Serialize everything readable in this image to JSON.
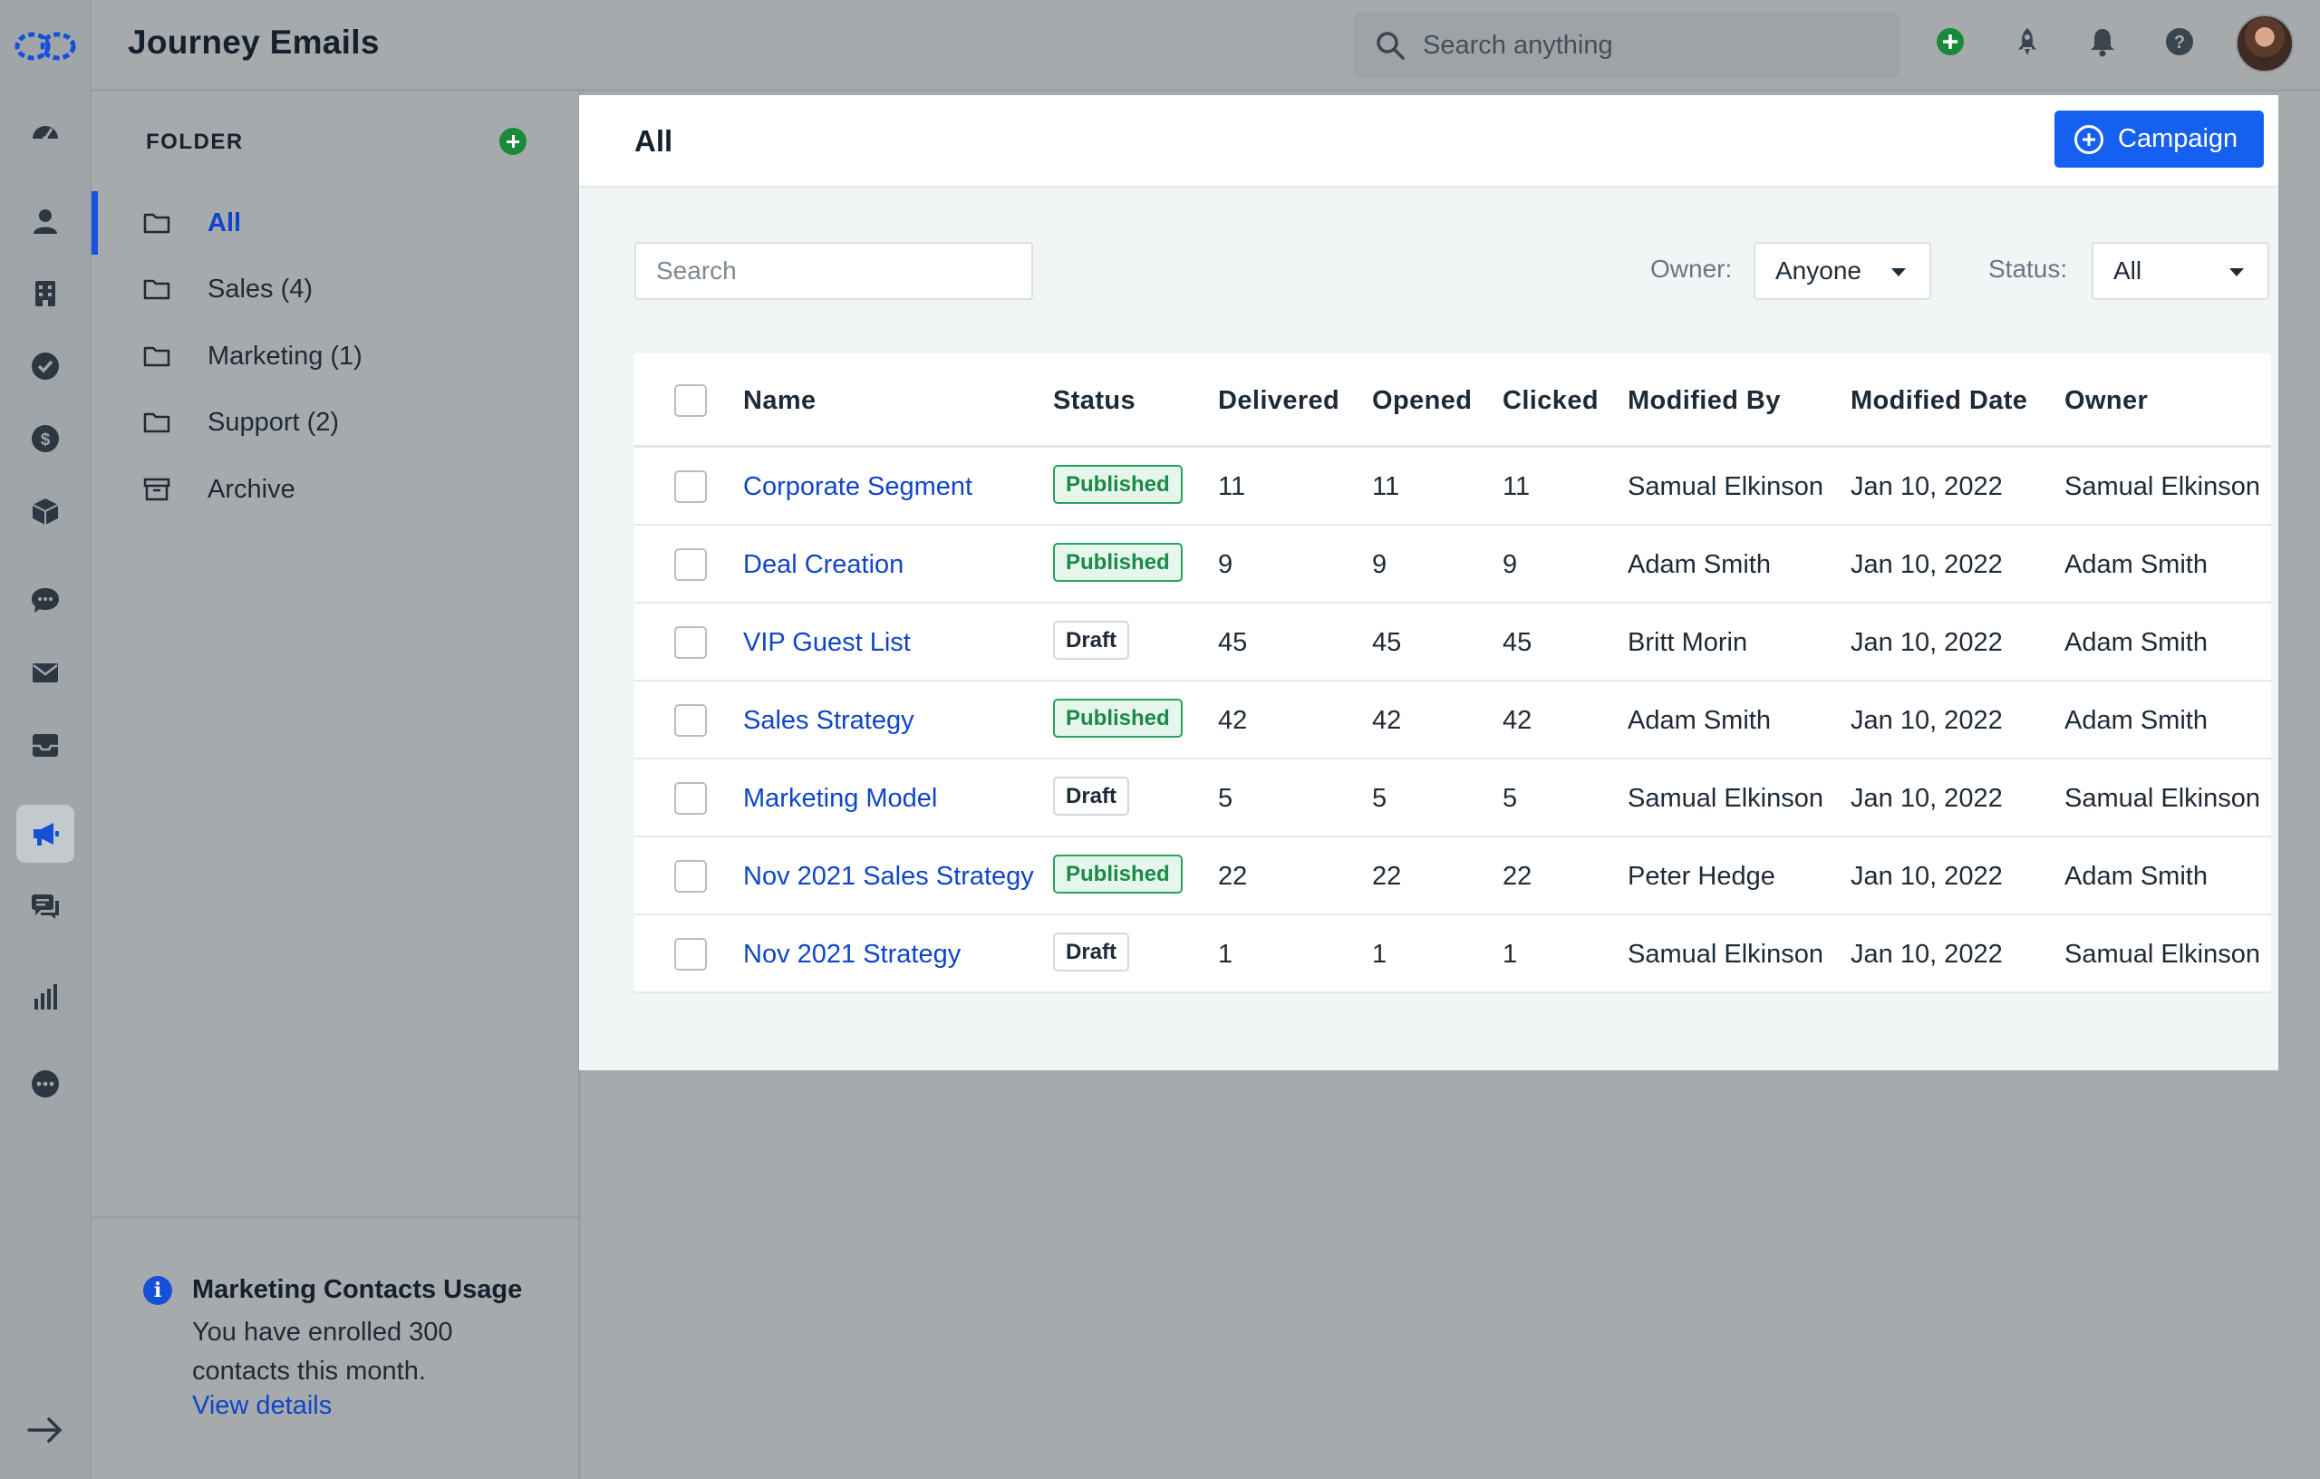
{
  "app": {
    "title": "Journey Emails"
  },
  "search": {
    "placeholder": "Search anything"
  },
  "rail": {
    "items": [
      {
        "name": "dashboard-icon"
      },
      {
        "name": "contacts-icon"
      },
      {
        "name": "companies-icon"
      },
      {
        "name": "tasks-icon"
      },
      {
        "name": "deals-icon"
      },
      {
        "name": "products-icon"
      },
      {
        "name": "chat-icon"
      },
      {
        "name": "email-icon"
      },
      {
        "name": "inbox-icon"
      },
      {
        "name": "megaphone-icon",
        "active": true
      },
      {
        "name": "conversations-icon"
      },
      {
        "name": "reports-icon"
      },
      {
        "name": "more-icon"
      }
    ]
  },
  "topbar": {
    "icons": [
      "add-icon",
      "rocket-icon",
      "bell-icon",
      "help-icon"
    ]
  },
  "folders": {
    "heading": "FOLDER",
    "items": [
      {
        "label": "All",
        "active": true
      },
      {
        "label": "Sales (4)"
      },
      {
        "label": "Marketing (1)"
      },
      {
        "label": "Support (2)"
      },
      {
        "label": "Archive"
      }
    ]
  },
  "usage": {
    "title": "Marketing Contacts Usage",
    "text": "You have enrolled 300 contacts this month.",
    "link": "View details"
  },
  "main": {
    "title": "All",
    "campaign_button": "Campaign",
    "search_placeholder": "Search",
    "owner_label": "Owner:",
    "owner_value": "Anyone",
    "status_label": "Status:",
    "status_value": "All"
  },
  "table": {
    "columns": [
      "Name",
      "Status",
      "Delivered",
      "Opened",
      "Clicked",
      "Modified By",
      "Modified Date",
      "Owner"
    ],
    "rows": [
      {
        "name": "Corporate Segment",
        "status": "Published",
        "delivered": "11",
        "opened": "11",
        "clicked": "11",
        "modified_by": "Samual Elkinson",
        "modified_date": "Jan 10, 2022",
        "owner": "Samual Elkinson"
      },
      {
        "name": "Deal Creation",
        "status": "Published",
        "delivered": "9",
        "opened": "9",
        "clicked": "9",
        "modified_by": "Adam Smith",
        "modified_date": "Jan 10, 2022",
        "owner": "Adam Smith"
      },
      {
        "name": "VIP Guest List",
        "status": "Draft",
        "delivered": "45",
        "opened": "45",
        "clicked": "45",
        "modified_by": "Britt Morin",
        "modified_date": "Jan 10, 2022",
        "owner": "Adam Smith"
      },
      {
        "name": "Sales Strategy",
        "status": "Published",
        "delivered": "42",
        "opened": "42",
        "clicked": "42",
        "modified_by": "Adam Smith",
        "modified_date": "Jan 10, 2022",
        "owner": "Adam Smith"
      },
      {
        "name": "Marketing Model",
        "status": "Draft",
        "delivered": "5",
        "opened": "5",
        "clicked": "5",
        "modified_by": "Samual Elkinson",
        "modified_date": "Jan 10, 2022",
        "owner": "Samual Elkinson"
      },
      {
        "name": "Nov 2021 Sales Strategy",
        "status": "Published",
        "delivered": "22",
        "opened": "22",
        "clicked": "22",
        "modified_by": "Peter Hedge",
        "modified_date": "Jan 10, 2022",
        "owner": "Adam Smith"
      },
      {
        "name": "Nov 2021 Strategy",
        "status": "Draft",
        "delivered": "1",
        "opened": "1",
        "clicked": "1",
        "modified_by": "Samual Elkinson",
        "modified_date": "Jan 10, 2022",
        "owner": "Samual Elkinson"
      }
    ]
  },
  "colors": {
    "accent": "#1560f0",
    "link": "#0f46c8",
    "published": "#1b8a48",
    "add_green": "#1a8a3a"
  }
}
